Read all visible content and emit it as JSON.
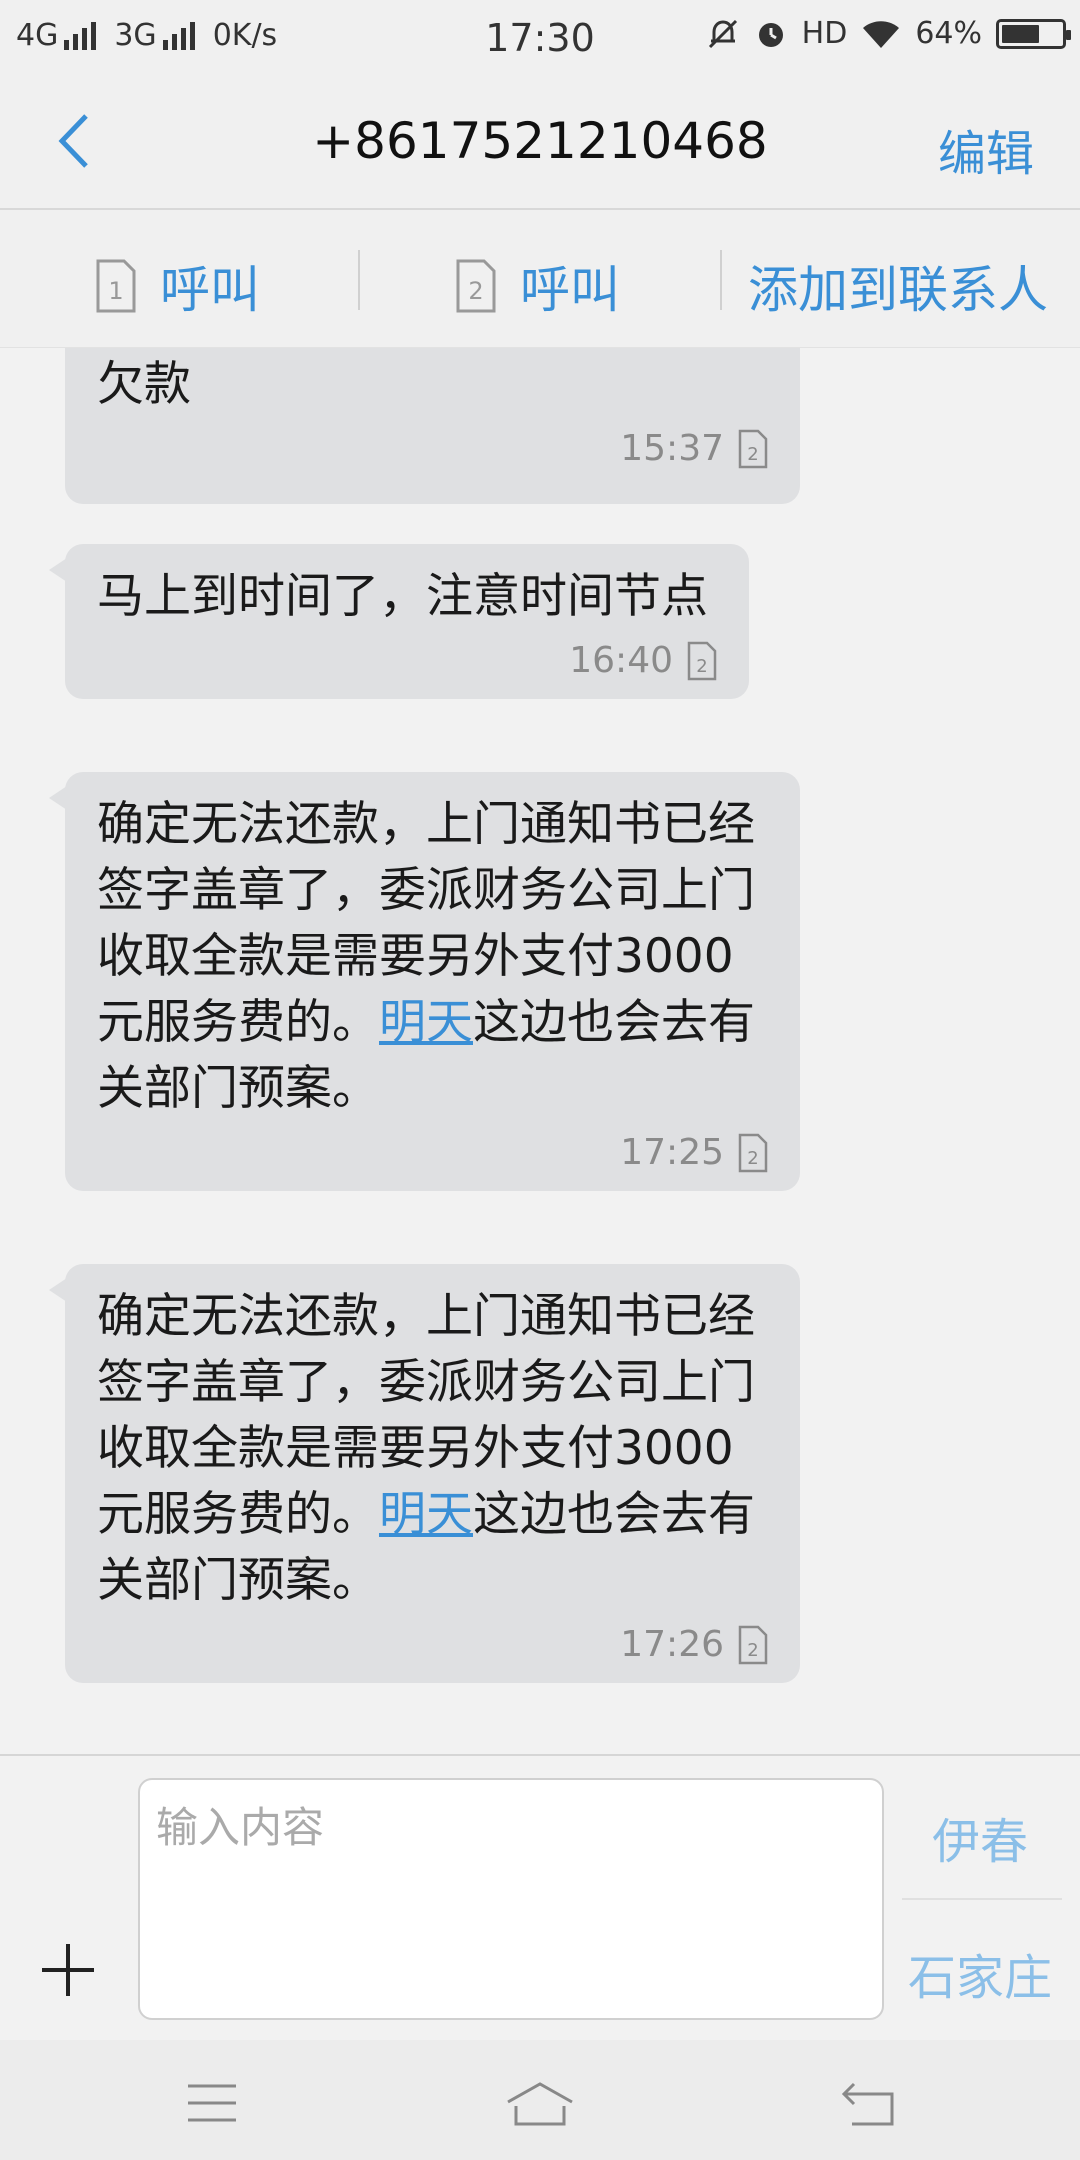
{
  "status_bar": {
    "network_1": "4G",
    "network_2": "3G",
    "speed": "0K/s",
    "time": "17:30",
    "hd": "HD",
    "battery_percent": "64%",
    "battery_level": 0.64
  },
  "nav": {
    "title": "+8617521210468",
    "edit_label": "编辑"
  },
  "actions": {
    "call_sim1": "呼叫",
    "sim1_number": "1",
    "call_sim2": "呼叫",
    "sim2_number": "2",
    "add_contact": "添加到联系人"
  },
  "messages": [
    {
      "text": "欠款",
      "time": "15:37",
      "sim": "2"
    },
    {
      "text": "马上到时间了，注意时间节点",
      "time": "16:40",
      "sim": "2"
    },
    {
      "text_before": "确定无法还款，上门通知书已经签字盖章了，委派财务公司上门收取全款是需要另外支付3000元服务费的。",
      "link": "明天",
      "text_after": "这边也会去有关部门预案。",
      "time": "17:25",
      "sim": "2"
    },
    {
      "text_before": "确定无法还款，上门通知书已经签字盖章了，委派财务公司上门收取全款是需要另外支付3000元服务费的。",
      "link": "明天",
      "text_after": "这边也会去有关部门预案。",
      "time": "17:26",
      "sim": "2"
    }
  ],
  "composer": {
    "placeholder": "输入内容",
    "send_sim1_label": "伊春",
    "send_sim2_label": "石家庄"
  },
  "colors": {
    "accent": "#3a8fd6",
    "bubble": "#dfe0e2",
    "send_disabled": "#8bbfe8"
  }
}
